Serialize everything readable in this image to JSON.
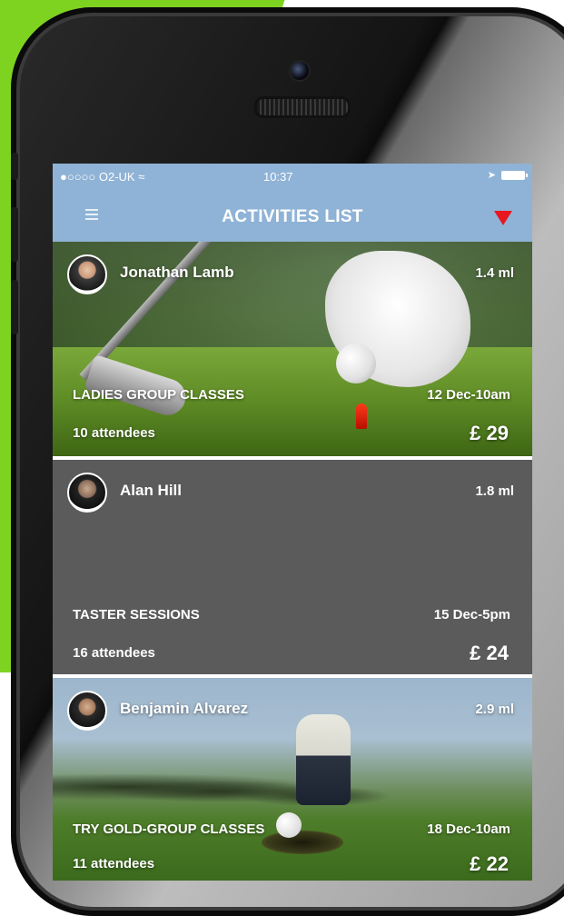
{
  "status_bar": {
    "carrier": "●○○○○ O2-UK",
    "wifi_icon": "wifi-icon",
    "time": "10:37",
    "location_icon": "location-arrow-icon",
    "battery_icon": "battery-icon"
  },
  "nav": {
    "title": "ACTIVITIES LIST",
    "menu_icon": "hamburger-menu-icon",
    "filter_icon": "filter-triangle-icon"
  },
  "colors": {
    "nav_bg": "#8fb3d6",
    "filter_icon": "#e8171f",
    "card_plain_bg": "#5b5b5b",
    "green_accent": "#7ed321"
  },
  "activities": [
    {
      "organizer": "Jonathan Lamb",
      "distance": "1.4 ml",
      "name": "LADIES GROUP CLASSES",
      "date": "12 Dec-10am",
      "attendees": "10 attendees",
      "price": "£ 29"
    },
    {
      "organizer": "Alan Hill",
      "distance": "1.8 ml",
      "name": "TASTER SESSIONS",
      "date": "15 Dec-5pm",
      "attendees": "16 attendees",
      "price": "£ 24"
    },
    {
      "organizer": "Benjamin Alvarez",
      "distance": "2.9 ml",
      "name": "TRY GOLD-GROUP CLASSES",
      "date": "18 Dec-10am",
      "attendees": "11 attendees",
      "price": "£ 22"
    }
  ]
}
